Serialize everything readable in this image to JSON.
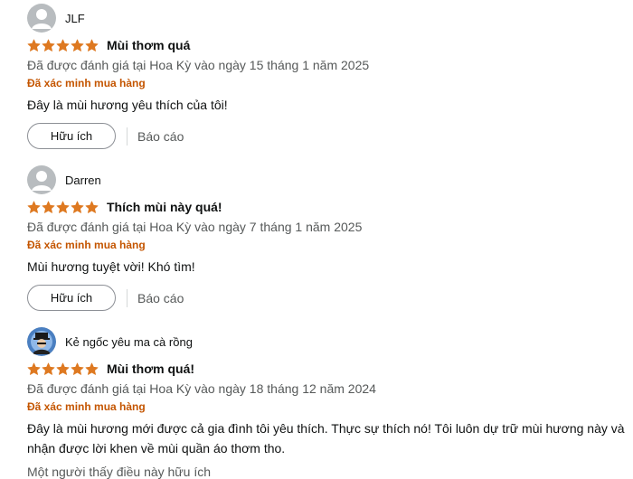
{
  "reviews": [
    {
      "name": "JLF",
      "rating": 5,
      "title": "Mùi thơm quá",
      "date": "Đã được đánh giá tại Hoa Kỳ vào ngày 15 tháng 1 năm 2025",
      "verified": "Đã xác minh mua hàng",
      "body": "Đây là mùi hương yêu thích của tôi!",
      "helpful_label": "Hữu ích",
      "report_label": "Báo cáo"
    },
    {
      "name": "Darren",
      "rating": 5,
      "title": "Thích mùi này quá!",
      "date": "Đã được đánh giá tại Hoa Kỳ vào ngày 7 tháng 1 năm 2025",
      "verified": "Đã xác minh mua hàng",
      "body": "Mùi hương tuyệt vời! Khó tìm!",
      "helpful_label": "Hữu ích",
      "report_label": "Báo cáo"
    },
    {
      "name": "Kẻ ngốc yêu ma cà rồng",
      "rating": 5,
      "title": "Mùi thơm quá!",
      "date": "Đã được đánh giá tại Hoa Kỳ vào ngày 18 tháng 12 năm 2024",
      "verified": "Đã xác minh mua hàng",
      "body": "Đây là mùi hương mới được cả gia đình tôi yêu thích. Thực sự thích nó! Tôi luôn dự trữ mùi hương này và nhận được lời khen về mùi quần áo thơm tho.",
      "helpful_count": "Một người thấy điều này hữu ích"
    }
  ],
  "colors": {
    "star": "#de7921",
    "verified": "#c45500",
    "muted": "#565959"
  }
}
